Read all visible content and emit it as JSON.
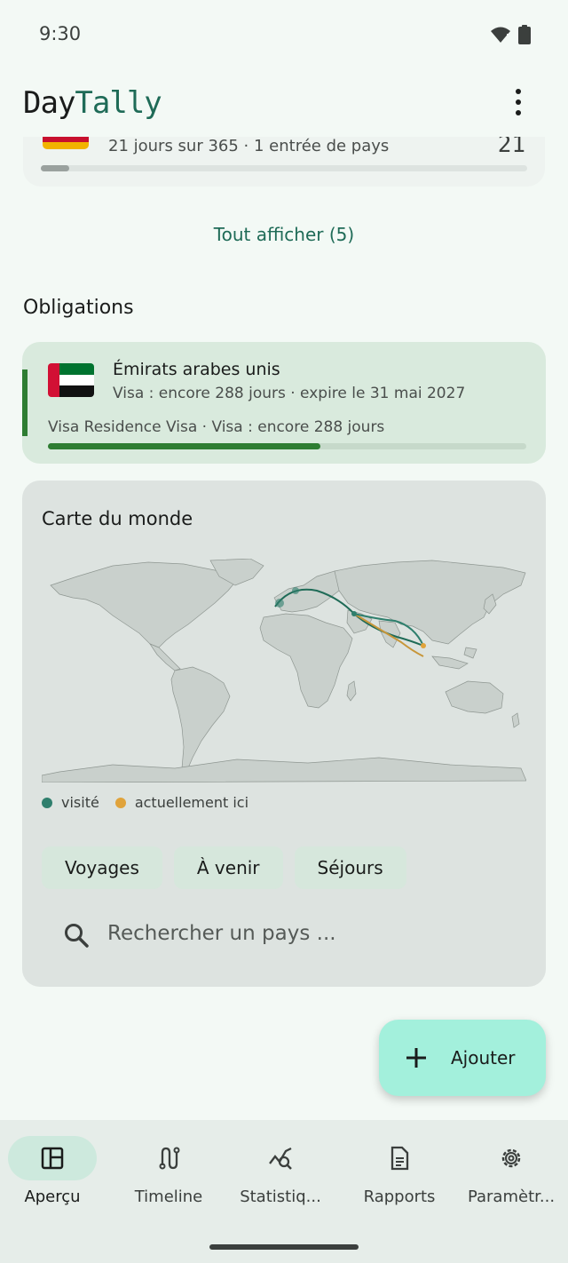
{
  "status_bar": {
    "time": "9:30",
    "icons": [
      "wifi-icon",
      "battery-icon"
    ]
  },
  "app": {
    "title_part1": "Day",
    "title_part2": "Tally",
    "menu_icon": "more-vert-icon",
    "accent_color": "#1f6b57"
  },
  "top_card": {
    "info": "21 jours sur 365  ·  1 entrée de pays",
    "count": "21",
    "progress_fraction": 0.058
  },
  "show_all": "Tout afficher (5)",
  "obligations": {
    "section_title": "Obligations",
    "country": "Émirats arabes unis",
    "detail": "Visa : encore 288 jours · expire le 31 mai 2027",
    "visa_line": "Visa Residence Visa · Visa : encore 288 jours",
    "progress_fraction": 0.57,
    "accent_color": "#2e7d32"
  },
  "world_map": {
    "title": "Carte du monde",
    "legend": [
      {
        "label": "visité",
        "color": "#2f7f6d"
      },
      {
        "label": "actuellement ici",
        "color": "#e0a33b"
      }
    ],
    "chips": [
      "Voyages",
      "À venir",
      "Séjours"
    ],
    "search_placeholder": "Rechercher un pays ..."
  },
  "fab": {
    "label": "Ajouter",
    "icon": "plus-icon"
  },
  "nav": {
    "items": [
      {
        "label": "Aperçu",
        "icon": "dashboard-icon",
        "active": true
      },
      {
        "label": "Timeline",
        "icon": "route-icon",
        "active": false
      },
      {
        "label": "Statistiq...",
        "icon": "query-stats-icon",
        "active": false
      },
      {
        "label": "Rapports",
        "icon": "document-icon",
        "active": false
      },
      {
        "label": "Paramètr...",
        "icon": "settings-icon",
        "active": false
      }
    ]
  }
}
